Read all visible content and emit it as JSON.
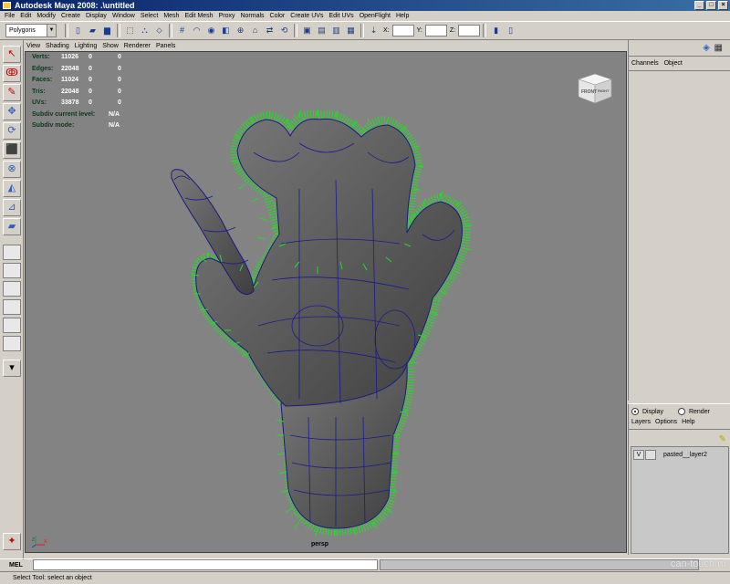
{
  "window": {
    "title": "Autodesk Maya 2008: .\\untitled",
    "controls": [
      "_",
      "□",
      "×"
    ]
  },
  "menubar": {
    "items": [
      "File",
      "Edit",
      "Modify",
      "Create",
      "Display",
      "Window",
      "Select",
      "Mesh",
      "Edit Mesh",
      "Proxy",
      "Normals",
      "Color",
      "Create UVs",
      "Edit UVs",
      "OpenFlight",
      "Help"
    ]
  },
  "toolbar": {
    "mode": "Polygons",
    "coord_labels": {
      "x": "X:",
      "y": "Y:",
      "z": "Z:"
    }
  },
  "viewport": {
    "menu": [
      "View",
      "Shading",
      "Lighting",
      "Show",
      "Renderer",
      "Panels"
    ],
    "camera": "persp",
    "hud": {
      "verts": {
        "label": "Verts:",
        "a": "11026",
        "b": "0",
        "c": "0"
      },
      "edges": {
        "label": "Edges:",
        "a": "22048",
        "b": "0",
        "c": "0"
      },
      "faces": {
        "label": "Faces:",
        "a": "11024",
        "b": "0",
        "c": "0"
      },
      "tris": {
        "label": "Tris:",
        "a": "22048",
        "b": "0",
        "c": "0"
      },
      "uvs": {
        "label": "UVs:",
        "a": "33878",
        "b": "0",
        "c": "0"
      },
      "subdiv_level": {
        "label": "Subdiv current level:",
        "value": "N/A"
      },
      "subdiv_mode": {
        "label": "Subdiv mode:",
        "value": "N/A"
      }
    },
    "viewcube": {
      "front": "FRONT",
      "right": "RIGHT"
    },
    "axis": {
      "x": "X",
      "z": "Z"
    }
  },
  "channel_box": {
    "menu": [
      "Channels",
      "Object"
    ]
  },
  "layer_editor": {
    "radio": [
      {
        "label": "Display",
        "checked": true
      },
      {
        "label": "Render",
        "checked": false
      }
    ],
    "menu": [
      "Layers",
      "Options",
      "Help"
    ],
    "layers": [
      {
        "visible": "V",
        "name": "pasted__layer2"
      }
    ]
  },
  "cmdline": {
    "label": "MEL"
  },
  "status": {
    "text": "Select Tool: select an object"
  },
  "watermark": "can-touch.ru",
  "colors": {
    "titlebar": "#0a246a",
    "viewport_bg": "#838383",
    "mesh": "#5a5a5a",
    "wire": "#1a1a80",
    "normals": "#22dd22"
  }
}
